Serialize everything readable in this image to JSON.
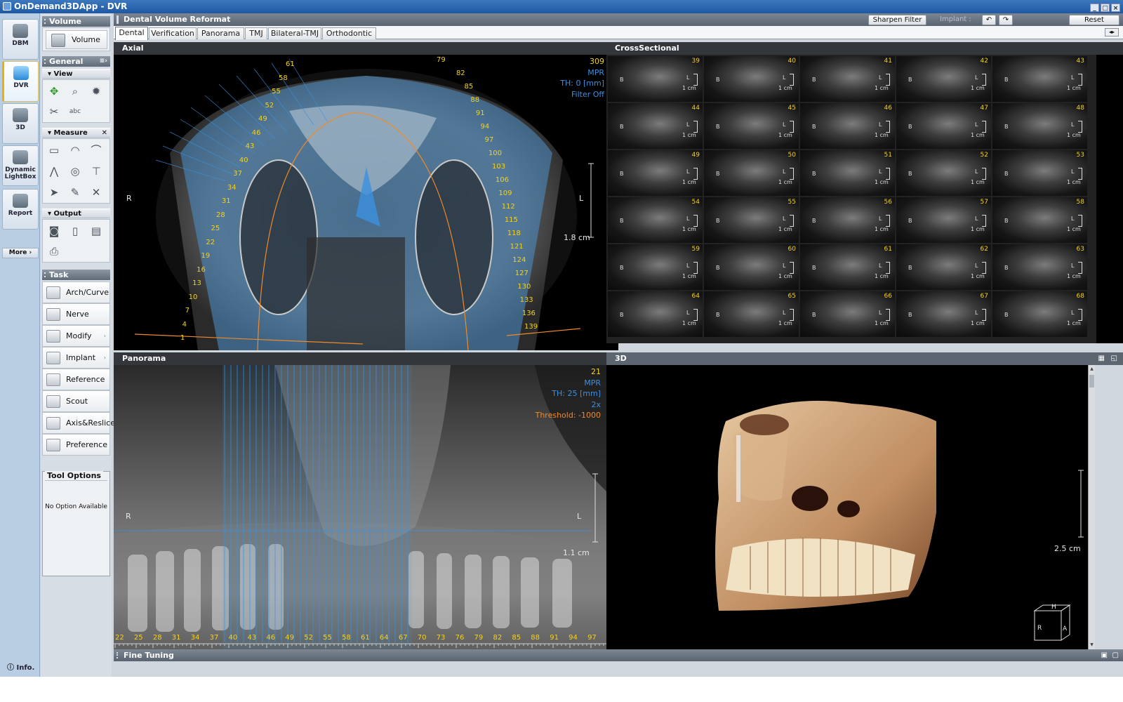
{
  "window": {
    "title": "OnDemand3DApp - DVR"
  },
  "nav": {
    "items": [
      {
        "label": "DBM",
        "icon": "database-icon"
      },
      {
        "label": "DVR",
        "icon": "tooth-icon"
      },
      {
        "label": "3D",
        "icon": "3d-view-icon"
      },
      {
        "label": "Dynamic LightBox",
        "icon": "lightbox-icon"
      },
      {
        "label": "Report",
        "icon": "report-icon"
      }
    ],
    "more": "More",
    "info": "Info."
  },
  "panel": {
    "volume_title": "Volume",
    "volume_button": "Volume",
    "general_title": "General",
    "view_title": "View",
    "measure_title": "Measure",
    "output_title": "Output",
    "task_title": "Task",
    "tasks": [
      "Arch/Curve",
      "Nerve",
      "Modify",
      "Implant",
      "Reference",
      "Scout",
      "Axis&Reslice",
      "Preference"
    ],
    "tool_options_title": "Tool Options",
    "tool_options_msg": "No Option Available"
  },
  "header": {
    "title": "Dental Volume Reformat",
    "sharpen": "Sharpen Filter",
    "implant": "Implant :",
    "reset": "Reset"
  },
  "tabs": [
    "Dental",
    "Verification",
    "Panorama",
    "TMJ",
    "Bilateral-TMJ",
    "Orthodontic"
  ],
  "axial": {
    "title": "Axial",
    "slice": "309",
    "mode": "MPR",
    "thickness": "TH: 0 [mm]",
    "filter": "Filter Off",
    "left": "L",
    "right": "R",
    "scale": "1.8 cm",
    "arch_labels": [
      "1",
      "4",
      "7",
      "10",
      "13",
      "16",
      "19",
      "22",
      "25",
      "28",
      "31",
      "34",
      "37",
      "40",
      "43",
      "46",
      "49",
      "52",
      "55",
      "58",
      "61",
      "79",
      "82",
      "85",
      "88",
      "91",
      "94",
      "97",
      "100",
      "103",
      "106",
      "109",
      "112",
      "115",
      "118",
      "121",
      "124",
      "127",
      "130",
      "133",
      "136",
      "139"
    ]
  },
  "cross": {
    "title": "CrossSectional",
    "first": 39,
    "rows": 6,
    "cols": 5,
    "b_label": "B",
    "l_label": "L",
    "unit": "1 cm"
  },
  "panorama": {
    "title": "Panorama",
    "slice": "21",
    "mode": "MPR",
    "thickness": "TH: 25 [mm]",
    "zoom": "2x",
    "threshold": "Threshold: -1000",
    "left": "L",
    "right": "R",
    "scale": "1.1 cm",
    "ticks": [
      "22",
      "25",
      "28",
      "31",
      "34",
      "37",
      "40",
      "43",
      "46",
      "49",
      "52",
      "55",
      "58",
      "61",
      "64",
      "67",
      "70",
      "73",
      "76",
      "79",
      "82",
      "85",
      "88",
      "91",
      "94",
      "97"
    ]
  },
  "threed": {
    "title": "3D",
    "scale": "2.5 cm",
    "cube": {
      "top": "H",
      "left": "R",
      "right": "A"
    }
  },
  "footer": {
    "title": "Fine Tuning"
  },
  "colors": {
    "overlay_yellow": "#f4d21a",
    "overlay_blue": "#3c90e0",
    "overlay_orange": "#f08a2a",
    "accent": "#1f58a2"
  }
}
